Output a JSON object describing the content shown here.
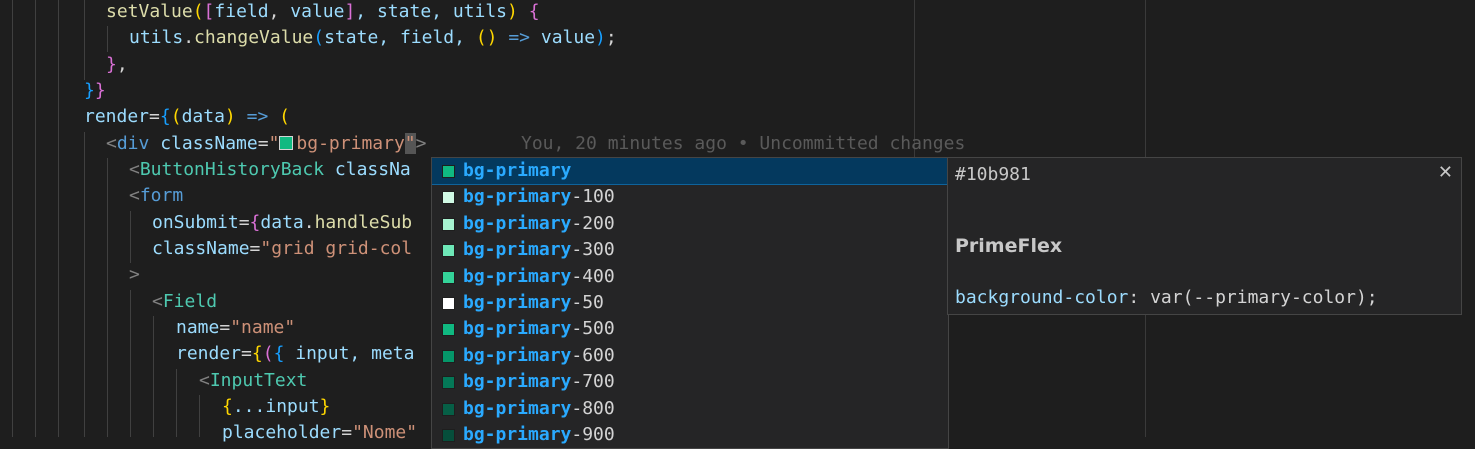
{
  "code": {
    "l1": {
      "fn": "setValue",
      "p1": "(",
      "b1": "[",
      "a": "field",
      "c": ", ",
      "b": "value",
      "b2": "]",
      "rest": ", state, utils",
      "p2": ")",
      "sp": " ",
      "br": "{"
    },
    "l2": {
      "obj": "utils",
      "dot": ".",
      "fn": "changeValue",
      "p1": "(",
      "args": "state, field, ",
      "p2": "()",
      "arrow": " => ",
      "v": "value",
      "p3": ")",
      "semi": ";"
    },
    "l3": {
      "br": "}",
      "c": ","
    },
    "l4": {
      "b1": "}",
      "b2": "}"
    },
    "l5": {
      "attr": "render",
      "eq": "=",
      "br": "{",
      "p1": "(",
      "arg": "data",
      "p2": ")",
      "arrow": " => ",
      "p3": "("
    },
    "l6": {
      "lt": "<",
      "tag": "div",
      "attr": " className",
      "eq": "=",
      "q": "\"",
      "val": "bg-primary",
      "q2": "\"",
      "gt": ">"
    },
    "l7": {
      "lt": "<",
      "tag": "ButtonHistoryBack",
      "attr": " classNa"
    },
    "l8": {
      "lt": "<",
      "tag": "form"
    },
    "l9": {
      "attr": "onSubmit",
      "eq": "=",
      "br": "{",
      "obj": "data",
      "dot": ".",
      "fn": "handleSub"
    },
    "l10": {
      "attr": "className",
      "eq": "=",
      "str": "\"grid grid-col"
    },
    "l11": {
      "gt": ">"
    },
    "l12": {
      "lt": "<",
      "tag": "Field"
    },
    "l13": {
      "attr": "name",
      "eq": "=",
      "str": "\"name\""
    },
    "l14": {
      "attr": "render",
      "eq": "=",
      "br": "{",
      "p1": "(",
      "br2": "{",
      "rest": " input, meta"
    },
    "l15": {
      "lt": "<",
      "tag": "InputText"
    },
    "l16": {
      "br": "{",
      "rest": "...input",
      "br2": "}"
    },
    "l17": {
      "attr": "placeholder",
      "eq": "=",
      "str": "\"Nome\""
    }
  },
  "blame": "You, 20 minutes ago • Uncommitted changes",
  "suggest": {
    "match": "bg-primary",
    "items": [
      {
        "suffix": "",
        "color": "#10b981"
      },
      {
        "suffix": "-100",
        "color": "#d1fae5"
      },
      {
        "suffix": "-200",
        "color": "#a7f3d0"
      },
      {
        "suffix": "-300",
        "color": "#6ee7b7"
      },
      {
        "suffix": "-400",
        "color": "#34d399"
      },
      {
        "suffix": "-50",
        "color": "#ffffff"
      },
      {
        "suffix": "-500",
        "color": "#10b981"
      },
      {
        "suffix": "-600",
        "color": "#059669"
      },
      {
        "suffix": "-700",
        "color": "#047857"
      },
      {
        "suffix": "-800",
        "color": "#065f46"
      },
      {
        "suffix": "-900",
        "color": "#064e3b"
      }
    ]
  },
  "details": {
    "hex": "#10b981",
    "title": "PrimeFlex",
    "prop": "background-color",
    "value": ": var(--primary-color);"
  }
}
